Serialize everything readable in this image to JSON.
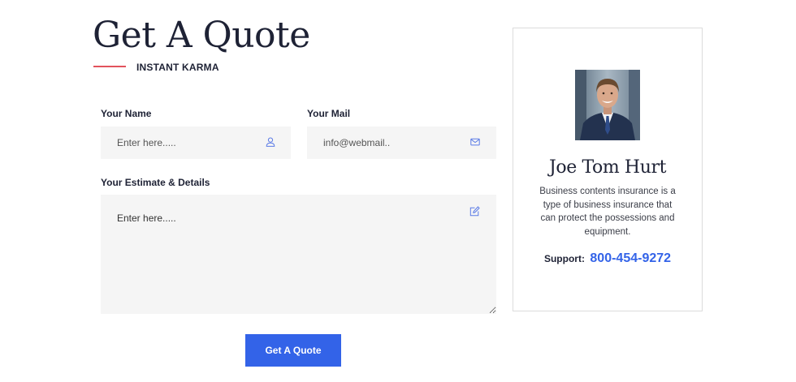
{
  "header": {
    "title": "Get A Quote",
    "subtitle": "INSTANT KARMA"
  },
  "form": {
    "name_label": "Your Name",
    "name_placeholder": "Enter here.....",
    "mail_label": "Your Mail",
    "mail_placeholder": "info@webmail..",
    "details_label": "Your Estimate & Details",
    "details_placeholder": "Enter here.....",
    "submit_label": "Get A Quote",
    "icons": {
      "name": "user-icon",
      "mail": "envelope-icon",
      "details": "edit-icon"
    }
  },
  "agent": {
    "name": "Joe Tom Hurt",
    "bio": "Business contents insurance is a type of business insurance that can protect the possessions and equipment.",
    "support_label": "Support:",
    "phone": "800-454-9272"
  },
  "colors": {
    "accent": "#3363e8",
    "title_underline": "#e2525c",
    "input_bg": "#f5f5f5",
    "text_dark": "#1e2235"
  }
}
